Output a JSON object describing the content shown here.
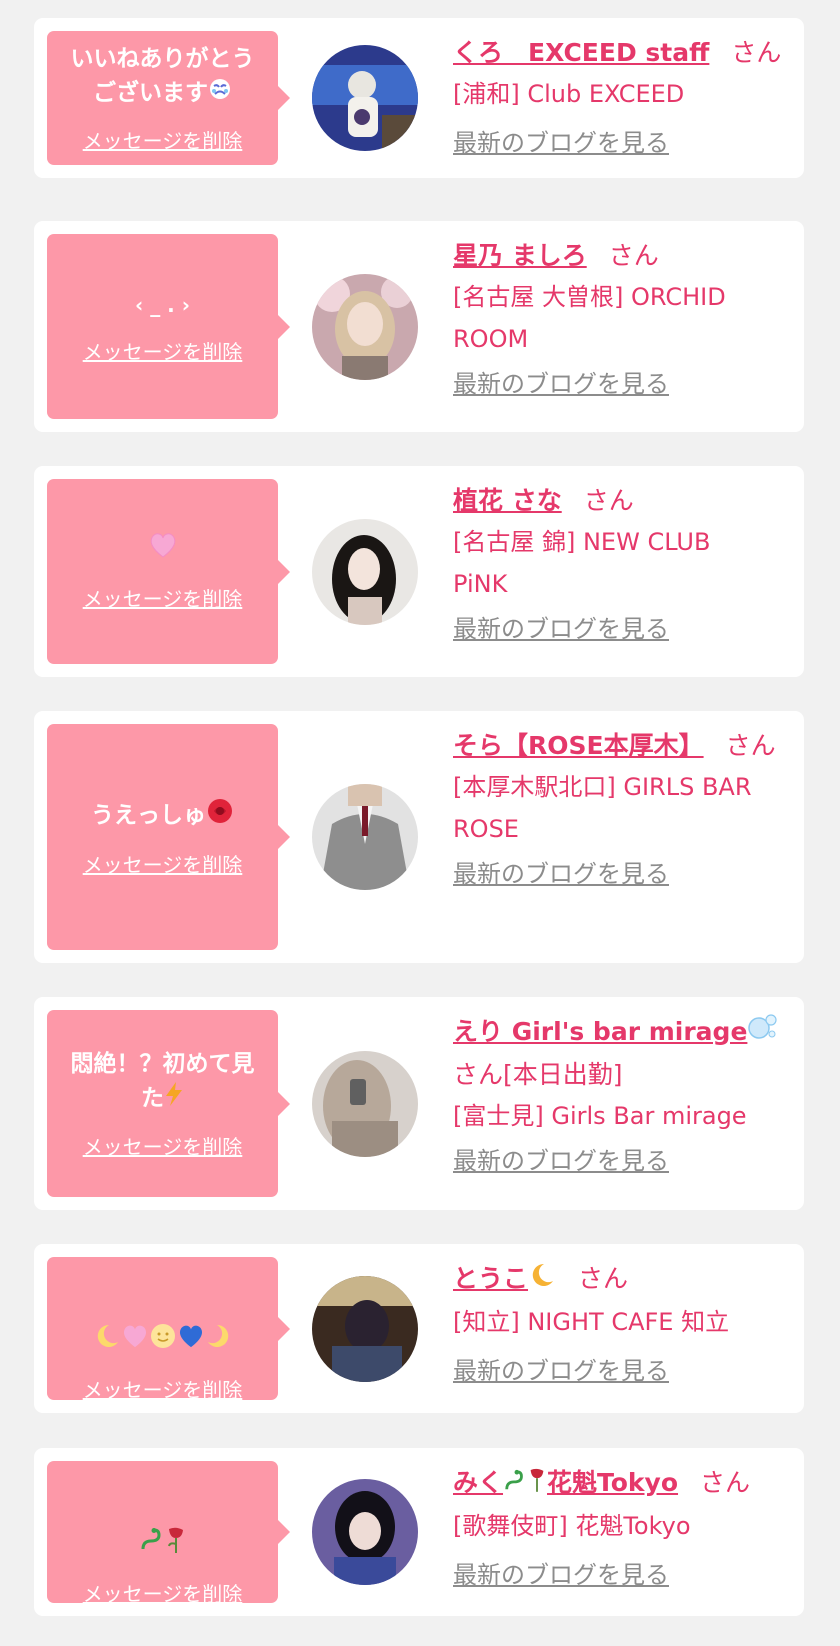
{
  "delete_label": "メッセージを削除",
  "blog_label": "最新のブログを見る",
  "honorific": "さん",
  "items": [
    {
      "message": "いいねありがとう\nございます",
      "message_emoji": "crying-face",
      "name": "くろ　EXCEED staff",
      "name_suffix": "",
      "shop": "[浦和] Club EXCEED",
      "avatar": "person-in-mascot-costume-aquarium"
    },
    {
      "message": "‹ _ . ›",
      "message_emoji": "",
      "name": "星乃 ましろ",
      "name_suffix": "",
      "shop": "[名古屋 大曽根] ORCHID ROOM",
      "avatar": "woman-with-blonde-hair-cherry-blossoms"
    },
    {
      "message": "",
      "message_emoji": "pink-heart",
      "name": "植花 さな",
      "name_suffix": "",
      "shop": "[名古屋 錦] NEW CLUB PiNK",
      "avatar": "woman-with-dark-hair"
    },
    {
      "message": "うえっしゅ",
      "message_emoji": "red-rose",
      "name": "そら【ROSE本厚木】",
      "name_suffix": "",
      "shop": "[本厚木駅北口] GIRLS BAR ROSE",
      "avatar": "man-in-grey-suit"
    },
    {
      "message": "悶絶！？初めて見\nた",
      "message_emoji": "lightning",
      "name": "えり Girl's bar mirage",
      "name_suffix": "[本日出勤]",
      "shop": "[富士見] Girls Bar mirage",
      "avatar": "woman-mirror-selfie"
    },
    {
      "message": "",
      "message_emoji": "moon-heart-sun-heart-moon",
      "name": "とうこ",
      "name_suffix": "",
      "shop": "[知立] NIGHT CAFE 知立",
      "avatar": "woman-seated-dark-room"
    },
    {
      "message": "",
      "message_emoji": "snake-wilted-rose",
      "name": "みく",
      "name_extra": "花魁Tokyo",
      "name_suffix": "",
      "shop": "[歌舞伎町] 花魁Tokyo",
      "avatar": "woman-black-hair-kimono"
    }
  ],
  "colors": {
    "background": "#f1f1f1",
    "bubble": "#fd98a8",
    "accent": "#e5386a",
    "link_grey": "#8c8c8c"
  }
}
